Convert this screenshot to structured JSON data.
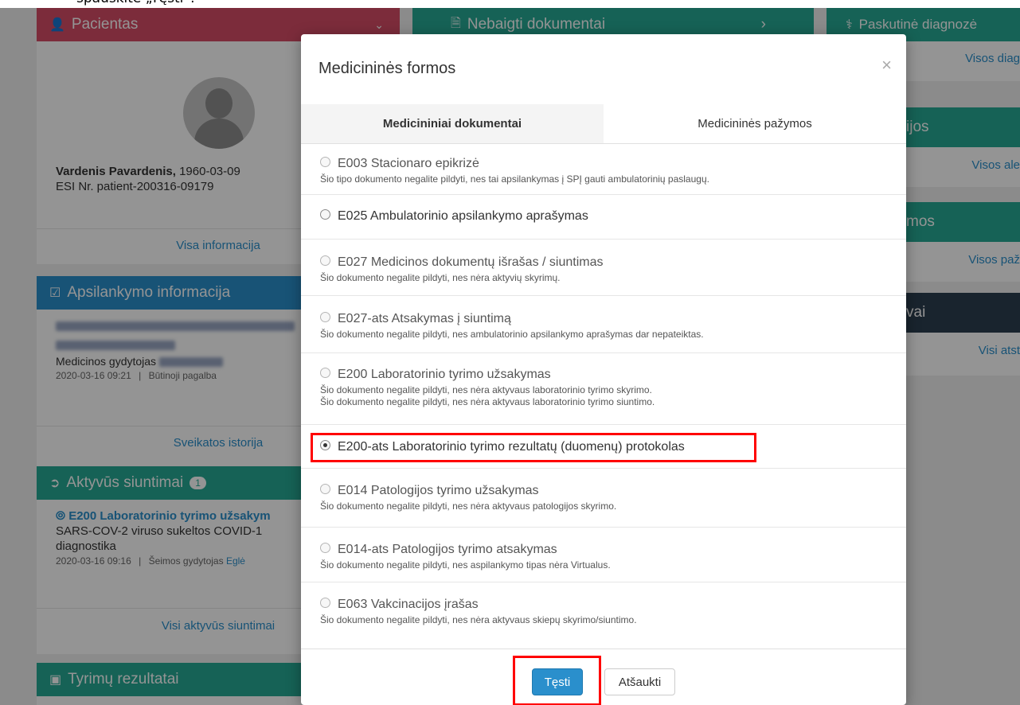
{
  "caption": "spauskite „Tęsti“.",
  "background": {
    "patient": {
      "title": "Pacientas",
      "name": "Vardenis Pavardenis,",
      "birth": "1960-03-09",
      "esi": "ESI Nr. patient-200316-09179",
      "link": "Visa informacija"
    },
    "visit": {
      "title": "Apsilankymo informacija",
      "doctor_role": "Medicinos gydytojas",
      "date": "2020-03-16 09:21",
      "separator": "|",
      "type": "Būtinoji pagalba",
      "link": "Sveikatos istorija"
    },
    "referrals": {
      "title": "Aktyvūs siuntimai",
      "count": "1",
      "item_title": "E200 Laboratorinio tyrimo užsakym",
      "item_desc": "SARS-COV-2 viruso sukeltos COVID-1",
      "item_desc2": "diagnostika",
      "item_date": "2020-03-16 09:16",
      "item_sep": "|",
      "item_doctor": "Šeimos gydytojas",
      "item_doctor_name": "Eglė",
      "link": "Visi aktyvūs siuntimai"
    },
    "tests": {
      "title": "Tyrimų rezultatai"
    },
    "unfinished": {
      "title": "Nebaigti dokumentai"
    },
    "diagnosis": {
      "title": "Paskutinė diagnozė",
      "link": "Visos diag"
    },
    "allergies": {
      "title": "ijos",
      "link": "Visos ale"
    },
    "certificates": {
      "title": "mos",
      "link": "Visos paž"
    },
    "responses": {
      "title": "vai",
      "link": "Visi atst"
    }
  },
  "modal": {
    "title": "Medicininės formos",
    "close": "×",
    "tabs": [
      {
        "label": "Medicininiai dokumentai",
        "active": true
      },
      {
        "label": "Medicininės pažymos",
        "active": false
      }
    ],
    "items": [
      {
        "label": "E003 Stacionaro epikrizė",
        "enabled": false,
        "selected": false,
        "notes": [
          "Šio tipo dokumento negalite pildyti, nes tai apsilankymas į SPĮ gauti ambulatorinių paslaugų."
        ]
      },
      {
        "label": "E025 Ambulatorinio apsilankymo aprašymas",
        "enabled": true,
        "selected": false,
        "notes": []
      },
      {
        "label": "E027 Medicinos dokumentų išrašas / siuntimas",
        "enabled": false,
        "selected": false,
        "notes": [
          "Šio dokumento negalite pildyti, nes nėra aktyvių skyrimų."
        ]
      },
      {
        "label": "E027-ats Atsakymas į siuntimą",
        "enabled": false,
        "selected": false,
        "notes": [
          "Šio dokumento negalite pildyti, nes ambulatorinio apsilankymo aprašymas dar nepateiktas."
        ]
      },
      {
        "label": "E200 Laboratorinio tyrimo užsakymas",
        "enabled": false,
        "selected": false,
        "notes": [
          "Šio dokumento negalite pildyti, nes nėra aktyvaus laboratorinio tyrimo skyrimo.",
          "Šio dokumento negalite pildyti, nes nėra aktyvaus laboratorinio tyrimo siuntimo."
        ]
      },
      {
        "label": "E200-ats Laboratorinio tyrimo rezultatų (duomenų) protokolas",
        "enabled": true,
        "selected": true,
        "notes": []
      },
      {
        "label": "E014 Patologijos tyrimo užsakymas",
        "enabled": false,
        "selected": false,
        "notes": [
          "Šio dokumento negalite pildyti, nes nėra aktyvaus patologijos skyrimo."
        ]
      },
      {
        "label": "E014-ats Patologijos tyrimo atsakymas",
        "enabled": false,
        "selected": false,
        "notes": [
          "Šio dokumento negalite pildyti, nes aspilankymo tipas nėra Virtualus."
        ]
      },
      {
        "label": "E063 Vakcinacijos įrašas",
        "enabled": false,
        "selected": false,
        "notes": [
          "Šio dokumento negalite pildyti, nes nėra aktyvaus skiepų skyrimo/siuntimo."
        ]
      }
    ],
    "buttons": {
      "continue": "Tęsti",
      "cancel": "Atšaukti"
    }
  },
  "colors": {
    "patient_header": "#d64d66",
    "visit_header": "#2a8fcc",
    "referrals_header": "#26aa94",
    "highlight": "#ff0000",
    "primary_button": "#2a8fcc"
  },
  "icons": {
    "patient": "user-icon",
    "visit": "check-square-icon",
    "referrals": "sign-in-icon",
    "tests": "archive-icon",
    "unfinished": "document-icon",
    "diagnosis": "stethoscope-icon"
  }
}
